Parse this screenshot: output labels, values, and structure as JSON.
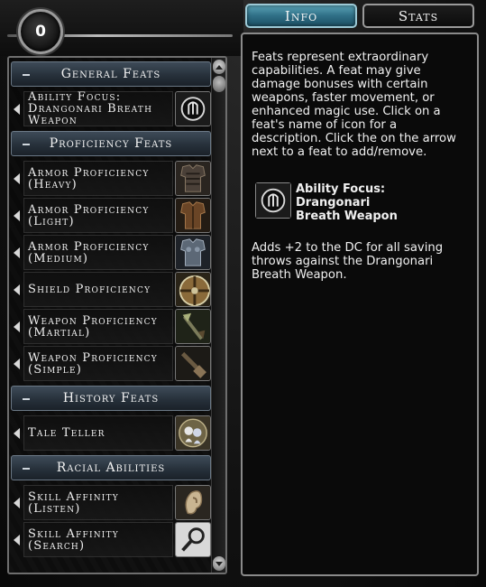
{
  "points_remaining": "0",
  "tabs": [
    {
      "label": "Info",
      "active": true
    },
    {
      "label": "Stats",
      "active": false
    }
  ],
  "sections": [
    {
      "header": "General Feats",
      "feats": [
        {
          "name": "Ability Focus:\nDrangonari Breath\nWeapon",
          "icon": "dragon-breath-icon"
        }
      ]
    },
    {
      "header": "Proficiency Feats",
      "feats": [
        {
          "name": "Armor Proficiency\n(Heavy)",
          "icon": "heavy-armor-icon"
        },
        {
          "name": "Armor Proficiency\n(Light)",
          "icon": "light-armor-icon"
        },
        {
          "name": "Armor Proficiency\n(Medium)",
          "icon": "medium-armor-icon"
        },
        {
          "name": "Shield Proficiency",
          "icon": "shield-icon"
        },
        {
          "name": "Weapon Proficiency\n(Martial)",
          "icon": "martial-weapon-icon"
        },
        {
          "name": "Weapon Proficiency\n(Simple)",
          "icon": "simple-weapon-icon"
        }
      ]
    },
    {
      "header": "History Feats",
      "feats": [
        {
          "name": "Tale Teller",
          "icon": "tale-teller-icon"
        }
      ]
    },
    {
      "header": "Racial Abilities",
      "feats": [
        {
          "name": "Skill Affinity (Listen)",
          "icon": "ear-icon"
        },
        {
          "name": "Skill Affinity\n(Search)",
          "icon": "magnifier-icon"
        }
      ]
    }
  ],
  "info": {
    "description": "Feats represent extraordinary capabilities. A feat may give damage bonuses with certain weapons, faster movement, or enhanced magic use. Click on a feat's name of icon for a description. Click the on the arrow next to a feat to add/remove.",
    "selected_title": "Ability Focus: Drangonari Breath Weapon",
    "selected_description": "Adds +2 to the DC for all saving throws against the Drangonari Breath Weapon."
  }
}
